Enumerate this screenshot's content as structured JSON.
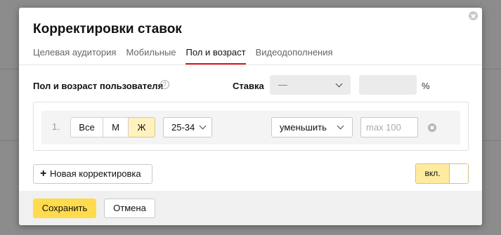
{
  "dialog": {
    "title": "Корректировки ставок",
    "tabs": [
      {
        "label": "Целевая аудитория"
      },
      {
        "label": "Мобильные"
      },
      {
        "label": "Пол и возраст"
      },
      {
        "label": "Видеодополнения"
      }
    ],
    "active_tab": "Пол и возраст"
  },
  "settings_row": {
    "label": "Пол и возраст пользователя",
    "help_glyph": "?",
    "rate_label": "Ставка",
    "rate_select_value": "—",
    "percent_sign": "%"
  },
  "adjustment": {
    "number": "1.",
    "gender_options": [
      "Все",
      "М",
      "Ж"
    ],
    "gender_selected": "Ж",
    "age_value": "25-34",
    "direction_value": "уменьшить",
    "value_placeholder": "max 100"
  },
  "actions": {
    "add_label": "Новая корректировка",
    "add_glyph": "+",
    "toggle_label": "вкл.",
    "toggle_on": true,
    "save_label": "Сохранить",
    "cancel_label": "Отмена"
  },
  "colors": {
    "accent_tab": "#e0121e",
    "primary_button": "#ffdb4d",
    "selected_segment": "#fff2bf"
  }
}
